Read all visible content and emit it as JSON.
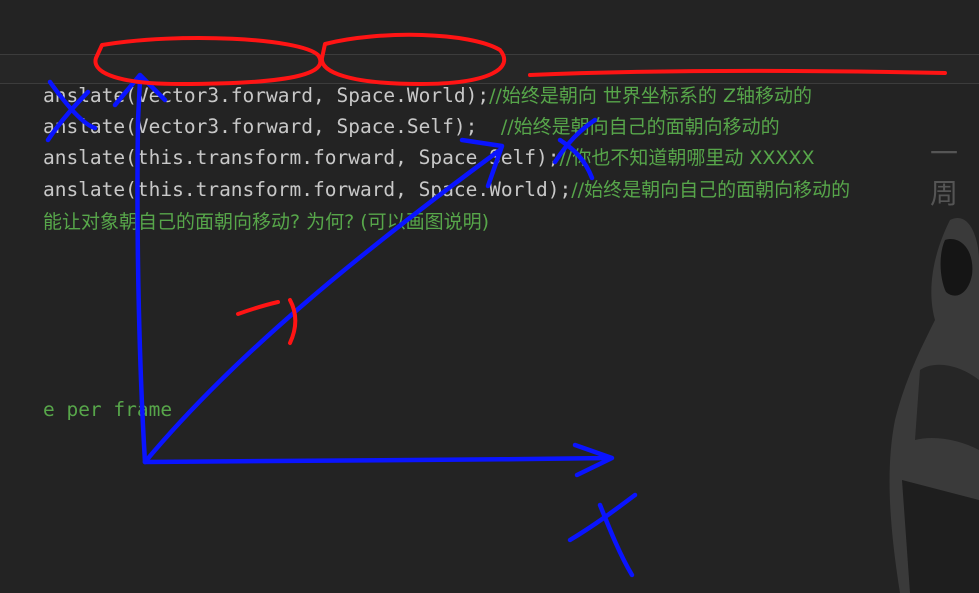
{
  "code_lines": [
    {
      "code": "anslate(Vector3.forward, Space.World);",
      "comment": "//始终是朝向 世界坐标系的 Z轴移动的"
    },
    {
      "code": "anslate(Vector3.forward, Space.Self);  ",
      "comment": "//始终是朝向自己的面朝向移动的"
    },
    {
      "code": "anslate(this.transform.forward, Space.Self);",
      "comment": "//你也不知道朝哪里动 XXXXX"
    },
    {
      "code": "anslate(this.transform.forward, Space.World);",
      "comment": "//始终是朝向自己的面朝向移动的"
    },
    {
      "code": "",
      "comment": "能让对象朝自己的面朝向移动? 为何? (可以画图说明)"
    },
    {
      "code": "",
      "comment": "e per frame"
    }
  ],
  "watermark": "一周",
  "annotations": {
    "x_labels": [
      "X",
      "X",
      "X"
    ],
    "colors": {
      "blue": "#0a14ff",
      "red": "#ff1414"
    }
  }
}
